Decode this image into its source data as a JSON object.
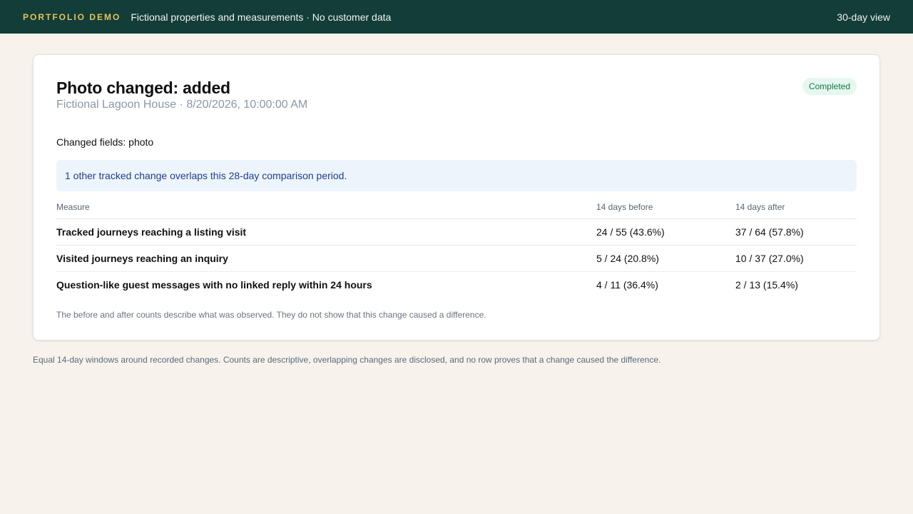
{
  "header": {
    "brand": "PORTFOLIO DEMO",
    "tagline": "Fictional properties and measurements · No customer data",
    "view": "30-day view"
  },
  "card": {
    "title": "Photo changed: added",
    "subtitle": "Fictional Lagoon House · 8/20/2026, 10:00:00 AM",
    "status": "Completed",
    "changed_fields": "Changed fields: photo",
    "notice": "1 other tracked change overlaps this 28-day comparison period.",
    "table": {
      "headers": [
        "Measure",
        "14 days before",
        "14 days after"
      ],
      "rows": [
        [
          "Tracked journeys reaching a listing visit",
          "24 / 55 (43.6%)",
          "37 / 64 (57.8%)"
        ],
        [
          "Visited journeys reaching an inquiry",
          "5 / 24 (20.8%)",
          "10 / 37 (27.0%)"
        ],
        [
          "Question-like guest messages with no linked reply within 24 hours",
          "4 / 11 (36.4%)",
          "2 / 13 (15.4%)"
        ]
      ]
    },
    "footnote": "The before and after counts describe what was observed. They do not show that this change caused a difference."
  },
  "page_note": "Equal 14-day windows around recorded changes. Counts are descriptive, overlapping changes are disclosed, and no row proves that a change caused the difference.",
  "colors": {
    "topbar": "#123d38",
    "brand": "#e8c25a",
    "badge_bg": "#e6f7ef",
    "badge_text": "#107a4a",
    "notice_bg": "#edf4fc",
    "notice_text": "#1f3f8a"
  }
}
